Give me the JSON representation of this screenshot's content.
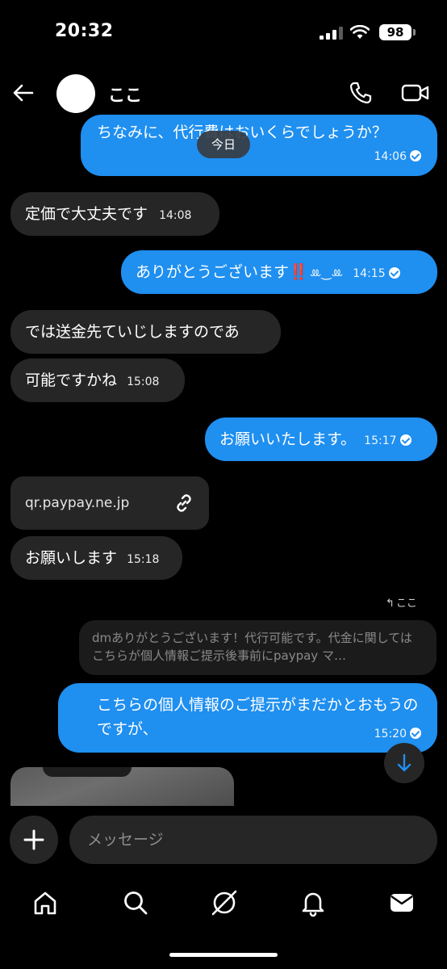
{
  "status_bar": {
    "time": "20:32",
    "battery": "98"
  },
  "header": {
    "contact_name": "ここ"
  },
  "date_separator": "今日",
  "messages": [
    {
      "text": "ちなみに、代行費はおいくらでしょうか？",
      "time": "14:06"
    },
    {
      "text": "定価で大丈夫です",
      "time": "14:08"
    },
    {
      "text": "ありがとうございます‼️",
      "emoji": "ꔛ‿ꔛ",
      "time": "14:15"
    },
    {
      "text": "では送金先ていじしますのであ"
    },
    {
      "text": "可能ですかね",
      "time": "15:08"
    },
    {
      "text": "お願いいたします。",
      "time": "15:17"
    },
    {
      "link": "qr.paypay.ne.jp"
    },
    {
      "text": "お願いします",
      "time": "15:18"
    },
    {
      "text": "こちらの個人情報のご提示がまだかとおもうのですが、",
      "time": "15:20"
    }
  ],
  "reply": {
    "label": "ここ",
    "quote": "dmありがとうございます！代行可能です。代金に関してはこちらが個人情報ご提示後事前にpaypay マ…"
  },
  "composer": {
    "placeholder": "メッセージ"
  },
  "nav": [
    "home-icon",
    "search-icon",
    "explore-icon",
    "bell-icon",
    "inbox-icon"
  ],
  "colors": {
    "outgoing": "#1f8ff0",
    "incoming": "#262626",
    "background": "#000000"
  }
}
